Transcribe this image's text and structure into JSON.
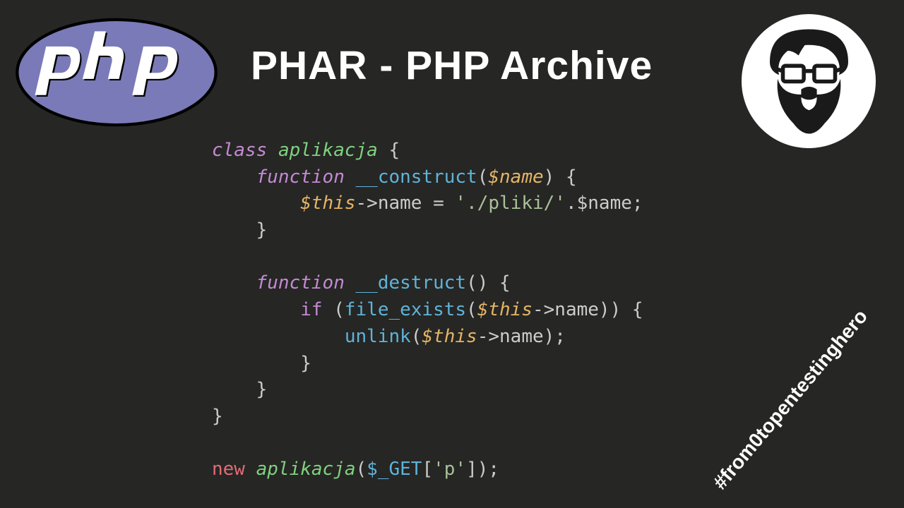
{
  "title": "PHAR - PHP Archive",
  "logo_text": "php",
  "hashtag": "#from0topentestinghero",
  "code": {
    "kw_class": "class",
    "class_name": "aplikacja",
    "kw_function": "function",
    "fn_construct": "__construct",
    "param_name": "$name",
    "var_this": "$this",
    "prop_name": "name",
    "str_path": "'./pliki/'",
    "fn_destruct": "__destruct",
    "kw_if": "if",
    "fn_file_exists": "file_exists",
    "fn_unlink": "unlink",
    "kw_new": "new",
    "gvar_get": "$_GET",
    "str_p": "'p'"
  }
}
